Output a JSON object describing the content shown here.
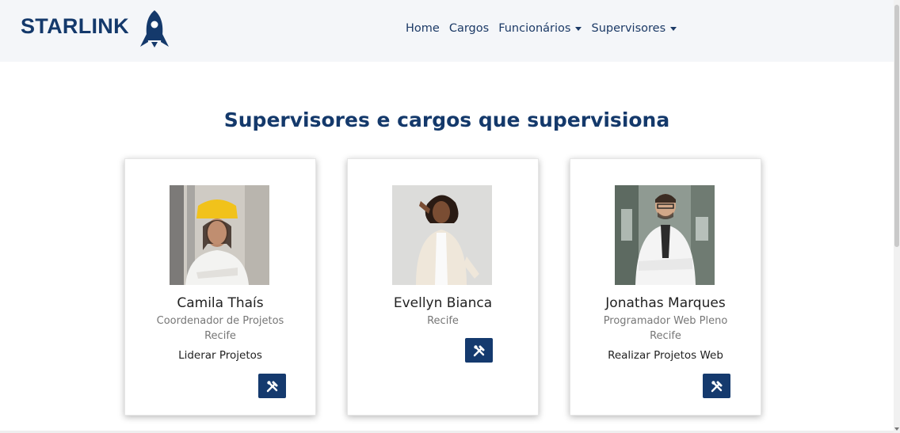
{
  "brand": {
    "name": "STARLINK"
  },
  "nav": {
    "home": "Home",
    "cargos": "Cargos",
    "funcionarios": "Funcionários",
    "supervisores": "Supervisores"
  },
  "page": {
    "title": "Supervisores e cargos que supervisiona"
  },
  "supervisors": [
    {
      "name": "Camila Thaís",
      "role": "Coordenador de Projetos",
      "city": "Recife",
      "task": "Liderar Projetos"
    },
    {
      "name": "Evellyn Bianca",
      "city": "Recife"
    },
    {
      "name": "Jonathas Marques",
      "role": "Programador Web Pleno",
      "city": "Recife",
      "task": "Realizar Projetos Web"
    }
  ],
  "colors": {
    "brand": "#14396b",
    "button": "#153a6e",
    "navbar_bg": "#f4f6f9"
  },
  "icons": {
    "logo": "rocket-icon",
    "action": "tools-icon"
  }
}
